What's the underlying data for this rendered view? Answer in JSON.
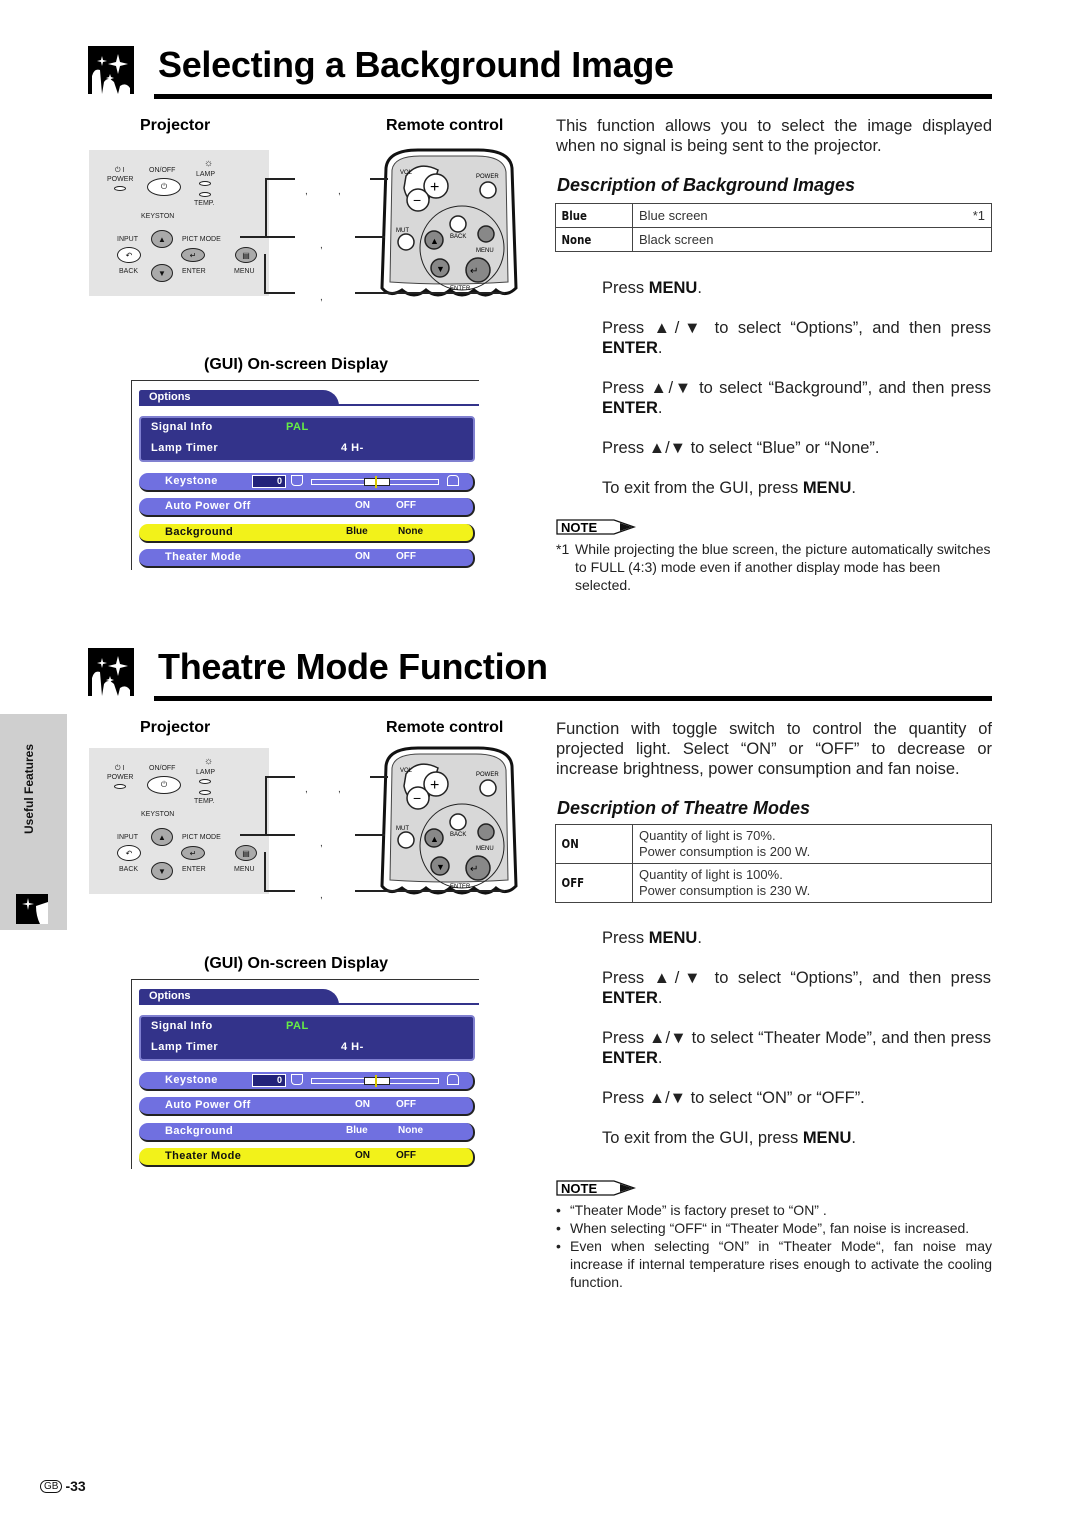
{
  "sections": [
    {
      "title": "Selecting a Background Image",
      "projector_label": "Projector",
      "remote_label": "Remote control",
      "gui_label": "GUI) On-screen Display",
      "intro": "This function allows you to select the image displayed when no signal is being sent to the projector.",
      "table_title": "Description of Background Images",
      "table": [
        {
          "key": "Blue",
          "value": "Blue screen",
          "footnote": "*1"
        },
        {
          "key": "None",
          "value": "Black screen",
          "footnote": ""
        }
      ],
      "steps": {
        "s1_pre": "Press ",
        "s1_b": "MENU",
        "s1_post": ".",
        "s2_pre": "Press ▲/▼ to select “Options”, and then press ",
        "s2_b": "ENTER",
        "s2_post": ".",
        "s3_pre": "Press ▲/▼ to select “Background”, and then press ",
        "s3_b": "ENTER",
        "s3_post": ".",
        "s4": "Press ▲/▼ to select “Blue” or “None”.",
        "s5_pre": "To exit from the GUI, press ",
        "s5_b": "MENU",
        "s5_post": "."
      },
      "note_label": "NOTE",
      "footnote_mark": "*1",
      "footnote_text": "While projecting the blue screen, the picture automatically switches to FULL (4:3) mode even if another display mode has been selected."
    },
    {
      "title": "Theatre Mode Function",
      "projector_label": "Projector",
      "remote_label": "Remote control",
      "gui_label": "GUI) On-screen Display",
      "intro": "Function with toggle switch to control the quantity of projected light. Select “ON” or “OFF” to decrease or increase brightness, power consumption and fan noise.",
      "table_title": "Description of Theatre Modes",
      "table": [
        {
          "key": "ON",
          "line1": "Quantity of light is 70%.",
          "line2": "Power consumption is 200 W."
        },
        {
          "key": "OFF",
          "line1": "Quantity of light is 100%.",
          "line2": "Power consumption is 230 W."
        }
      ],
      "steps": {
        "s1_pre": "Press ",
        "s1_b": "MENU",
        "s1_post": ".",
        "s2_pre": "Press ▲/▼ to select “Options”, and then press ",
        "s2_b": "ENTER",
        "s2_post": ".",
        "s3_pre": "Press ▲/▼ to select “Theater Mode”, and then press ",
        "s3_b": "ENTER",
        "s3_post": ".",
        "s4": "Press ▲/▼ to select “ON” or “OFF”.",
        "s5_pre": "To exit from the GUI, press ",
        "s5_b": "MENU",
        "s5_post": "."
      },
      "note_label": "NOTE",
      "notes": [
        "“Theater Mode” is factory preset to “ON” .",
        "When selecting “OFF“ in “Theater Mode”, fan noise is increased.",
        "Even when selecting “ON” in “Theater Mode“, fan noise may increase if internal temperature rises enough to activate the cooling function."
      ]
    }
  ],
  "projector_panel": {
    "power": "POWER",
    "power_sym": "⏻ I",
    "onoff": "ON/OFF",
    "lamp": "LAMP",
    "temp": "TEMP.",
    "keystone": "KEYSTON",
    "input": "INPUT",
    "pict_mode": "PICT MODE",
    "back": "BACK",
    "enter": "ENTER",
    "menu": "MENU"
  },
  "remote_panel": {
    "vol": "VOL",
    "power": "POWER",
    "mute": "MUT",
    "back": "BACK",
    "menu": "MENU",
    "enter": "ENTER"
  },
  "gui_menu": {
    "tab": "Options",
    "signal_info_label": "Signal Info",
    "signal_info_value": "PAL",
    "lamp_timer_label": "Lamp Timer",
    "lamp_timer_value": "4 H-",
    "keystone_label": "Keystone",
    "keystone_value": "0",
    "auto_power_off_label": "Auto Power Off",
    "auto_power_off_on": "ON",
    "auto_power_off_off": "OFF",
    "background_label": "Background",
    "background_blue": "Blue",
    "background_none": "None",
    "theater_mode_label": "Theater Mode",
    "theater_on": "ON",
    "theater_off": "OFF",
    "colors": {
      "panel": "#33338a",
      "item": "#7070e0",
      "selected": "#f2f21a",
      "pal": "#66ee44"
    }
  },
  "side_tab": {
    "label": "Useful Features"
  },
  "footer": {
    "region": "GB",
    "page": "-33"
  }
}
